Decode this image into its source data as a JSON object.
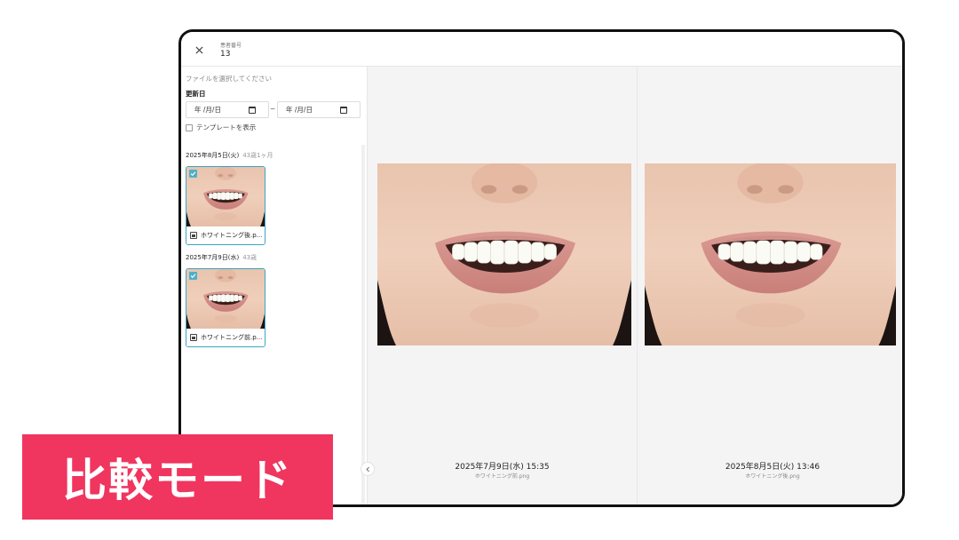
{
  "header": {
    "patient_label": "患者番号",
    "patient_value": "13"
  },
  "sidebar": {
    "hint": "ファイルを選択してください",
    "date_label": "更新日",
    "date_from_placeholder": "年 /月/日",
    "date_to_placeholder": "年 /月/日",
    "range_separator": "~",
    "template_label": "テンプレートを表示",
    "template_checked": false,
    "groups": [
      {
        "date": "2025年8月5日(火)",
        "age": "43歳1ヶ月",
        "file_name": "ホワイトニング後.p...",
        "selected": true
      },
      {
        "date": "2025年7月9日(水)",
        "age": "43歳",
        "file_name": "ホワイトニング前.p...",
        "selected": true
      }
    ]
  },
  "compare": {
    "left": {
      "timestamp": "2025年7月9日(水) 15:35",
      "file": "ホワイトニング前.png"
    },
    "right": {
      "timestamp": "2025年8月5日(火) 13:46",
      "file": "ホワイトニング後.png"
    }
  },
  "badge": {
    "label": "比較モード",
    "color": "#f0355f"
  },
  "colors": {
    "accent": "#3aa6c2",
    "panel_bg": "#f4f4f4"
  },
  "icons": [
    "close-icon",
    "calendar-icon",
    "checkbox-icon",
    "image-file-icon",
    "chevron-left-icon"
  ]
}
